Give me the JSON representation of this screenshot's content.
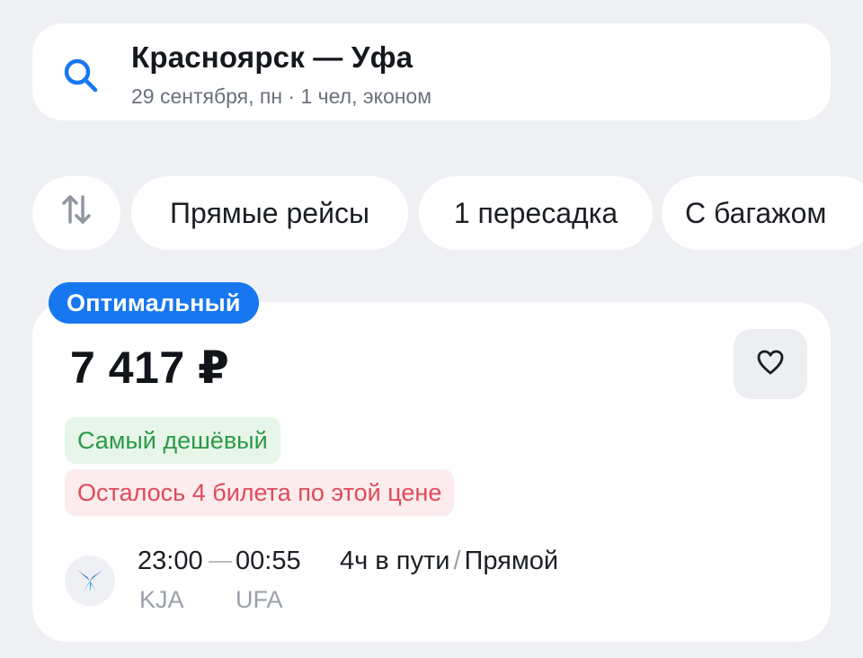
{
  "search": {
    "route": "Красноярск — Уфа",
    "details": "29 сентября, пн · 1 чел, эконом"
  },
  "filters": {
    "sort_icon": "sort-arrows-icon",
    "items": [
      "Прямые рейсы",
      "1 пересадка",
      "С багажом"
    ]
  },
  "ticket": {
    "badge": "Оптимальный",
    "price": "7 417 ₽",
    "tags": {
      "cheapest": "Самый дешёвый",
      "seats_left": "Осталось 4 билета по этой цене"
    },
    "flight": {
      "departure_time": "23:00",
      "arrival_time": "00:55",
      "departure_code": "KJA",
      "arrival_code": "UFA",
      "duration": "4ч в пути",
      "separator": "/",
      "type": "Прямой"
    }
  },
  "colors": {
    "accent": "#1777f0",
    "cheap_text": "#2b9a46",
    "warning_text": "#df4a5a",
    "background": "#eef0f3"
  }
}
